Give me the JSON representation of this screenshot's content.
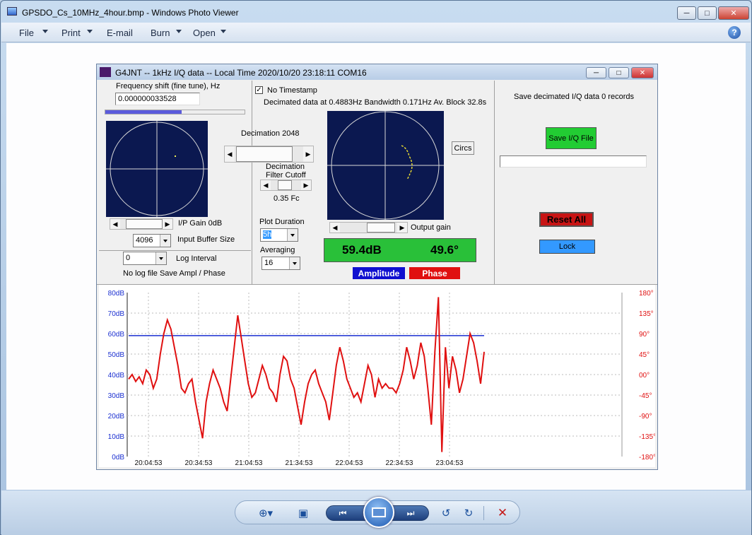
{
  "window": {
    "title": "GPSDO_Cs_10MHz_4hour.bmp - Windows Photo Viewer"
  },
  "menu": {
    "file": "File",
    "print": "Print",
    "email": "E-mail",
    "burn": "Burn",
    "open": "Open",
    "help": "?"
  },
  "app": {
    "title": "G4JNT  -- 1kHz I/Q data  --  Local Time  2020/10/20  23:18:11    COM16",
    "freq_label": "Frequency shift (fine tune),  Hz",
    "freq_value": "0.000000033528",
    "ip_gain": "I/P Gain 0dB",
    "buffer_value": "4096",
    "buffer_label": "Input Buffer Size",
    "log_value": "0",
    "log_label": "Log Interval",
    "log_status": "No log file  Save Ampl / Phase",
    "no_timestamp": "No Timestamp",
    "decimated_info": "Decimated data at 0.4883Hz  Bandwidth 0.171Hz   Av. Block 32.8s",
    "decimation": "Decimation  2048",
    "dec_filter_1": "Decimation",
    "dec_filter_2": "Filter Cutoff",
    "fc": "0.35 Fc",
    "plot_duration_label": "Plot Duration",
    "plot_duration_value": "5h",
    "averaging_label": "Averaging",
    "averaging_value": "16",
    "circs": "Circs",
    "output_gain": "Output gain",
    "readout_db": "59.4dB",
    "readout_deg": "49.6°",
    "amplitude": "Amplitude",
    "phase": "Phase",
    "save_iq_label": "Save decimated I/Q data  0 records",
    "save_iq_button": "Save I/Q File",
    "reset_all": "Reset All",
    "lock": "Lock"
  },
  "chart_data": {
    "type": "line",
    "x_ticks": [
      "20:04:53",
      "20:34:53",
      "21:04:53",
      "21:34:53",
      "22:04:53",
      "22:34:53",
      "23:04:53"
    ],
    "y_left_ticks": [
      "80dB",
      "70dB",
      "60dB",
      "50dB",
      "40dB",
      "30dB",
      "20dB",
      "10dB",
      "0dB"
    ],
    "y_right_ticks": [
      "180°",
      "135°",
      "90°",
      "45°",
      "00°",
      "-45°",
      "-90°",
      "-135°",
      "-180°"
    ],
    "ylim_left": [
      0,
      80
    ],
    "ylim_right": [
      -180,
      180
    ],
    "grid": true,
    "series": [
      {
        "name": "Amplitude",
        "color": "#1a2fd0",
        "axis": "left",
        "values": [
          59,
          59,
          59,
          59,
          59,
          59,
          59,
          59,
          59,
          59,
          59,
          59,
          59,
          59,
          59,
          59,
          59,
          59,
          59,
          59,
          59,
          59,
          59,
          59,
          59,
          59,
          59,
          59,
          59,
          59,
          59,
          59,
          59,
          59,
          59,
          59,
          59,
          59,
          59,
          59,
          59,
          59,
          59,
          59,
          59,
          59,
          59,
          59,
          59,
          59,
          59,
          59,
          59,
          59,
          59,
          59,
          59,
          59,
          59,
          59,
          59,
          59,
          59,
          59,
          59,
          59,
          59,
          59,
          59,
          59,
          59,
          59,
          59,
          59,
          59,
          59,
          59,
          59,
          59,
          59,
          59,
          59,
          59,
          59,
          59,
          59,
          59,
          59,
          59,
          59,
          59,
          59,
          59,
          59,
          59,
          59,
          59,
          59,
          59,
          59,
          59
        ]
      },
      {
        "name": "Phase",
        "color": "#e01010",
        "axis": "right",
        "values": [
          -10,
          0,
          -15,
          -5,
          -20,
          10,
          0,
          -30,
          -10,
          45,
          90,
          120,
          100,
          60,
          20,
          -30,
          -40,
          -20,
          -10,
          -60,
          -100,
          -140,
          -60,
          -20,
          10,
          -10,
          -30,
          -60,
          -80,
          -10,
          60,
          130,
          80,
          30,
          -20,
          -50,
          -40,
          -10,
          20,
          0,
          -30,
          -40,
          -60,
          0,
          40,
          30,
          -10,
          -30,
          -70,
          -110,
          -60,
          -20,
          0,
          10,
          -20,
          -40,
          -60,
          -100,
          -40,
          20,
          60,
          30,
          -10,
          -30,
          -50,
          -40,
          -60,
          -20,
          20,
          0,
          -50,
          -10,
          -30,
          -20,
          -30,
          -30,
          -40,
          -20,
          10,
          60,
          30,
          -10,
          20,
          70,
          40,
          -30,
          -110,
          50,
          170,
          -170,
          60,
          -30,
          40,
          10,
          -40,
          -10,
          40,
          90,
          70,
          30,
          -20,
          50
        ]
      }
    ]
  }
}
